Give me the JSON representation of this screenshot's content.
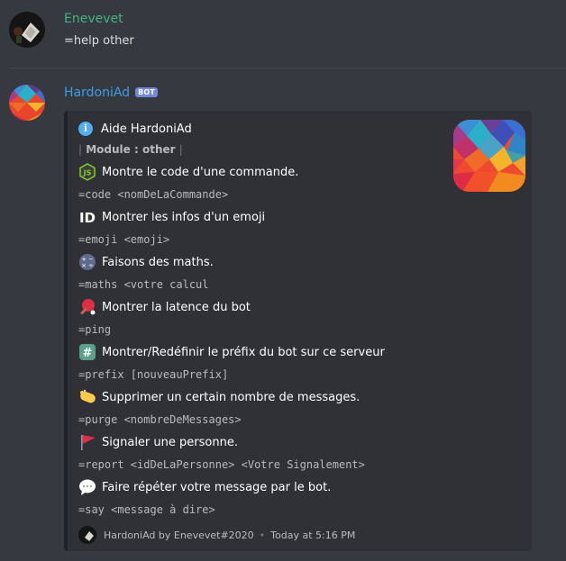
{
  "messages": [
    {
      "username": "Enevevet",
      "username_color": "#43b581",
      "content": "=help other"
    },
    {
      "username": "HardoniAd",
      "username_color": "#3d9ee8",
      "bot_tag": "BOT",
      "embed": {
        "author": "Aide HardoniAd",
        "module": "Module : other",
        "fields": [
          {
            "icon": "js-icon",
            "name": "Montre le code d'une commande.",
            "value": "=code <nomDeLaCommande>"
          },
          {
            "icon": "id-icon",
            "name": "Montrer les infos d'un emoji",
            "value": "=emoji <emoji>"
          },
          {
            "icon": "math-icon",
            "name": "Faisons des maths.",
            "value": "=maths <votre calcul"
          },
          {
            "icon": "ping-pong-icon",
            "name": "Montrer la latence du bot",
            "value": "=ping"
          },
          {
            "icon": "hashtag-icon",
            "name": "Montrer/Redéfinir le préfix du bot sur ce serveur",
            "value": "=prefix [nouveauPrefix]"
          },
          {
            "icon": "soap-icon",
            "name": "Supprimer un certain nombre de messages.",
            "value": "=purge <nombreDeMessages>"
          },
          {
            "icon": "red-flag-icon",
            "name": "Signaler une personne.",
            "value": "=report <idDeLaPersonne> <Votre Signalement>"
          },
          {
            "icon": "speech-bubble-icon",
            "name": "Faire répéter votre message par le bot.",
            "value": "=say <message à dire>"
          }
        ],
        "footer_text": "HardoniAd by Enevevet#2020",
        "timestamp": "Today at 5:16 PM"
      }
    }
  ]
}
